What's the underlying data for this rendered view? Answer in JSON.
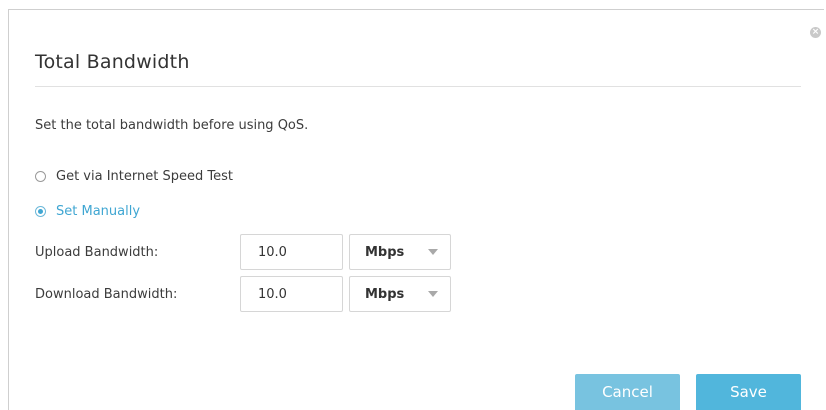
{
  "dialog": {
    "title": "Total Bandwidth",
    "description": "Set the total bandwidth before using QoS.",
    "close_icon": "close-icon"
  },
  "options": [
    {
      "label": "Get via Internet Speed Test",
      "checked": false
    },
    {
      "label": "Set Manually",
      "checked": true
    }
  ],
  "fields": {
    "upload": {
      "label": "Upload Bandwidth:",
      "value": "10.0",
      "unit": "Mbps"
    },
    "download": {
      "label": "Download Bandwidth:",
      "value": "10.0",
      "unit": "Mbps"
    }
  },
  "buttons": {
    "cancel_label": "Cancel",
    "save_label": "Save"
  },
  "colors": {
    "accent": "#3fa6d2",
    "cancel_button": "#78c3e0",
    "save_button": "#51b6dc"
  }
}
